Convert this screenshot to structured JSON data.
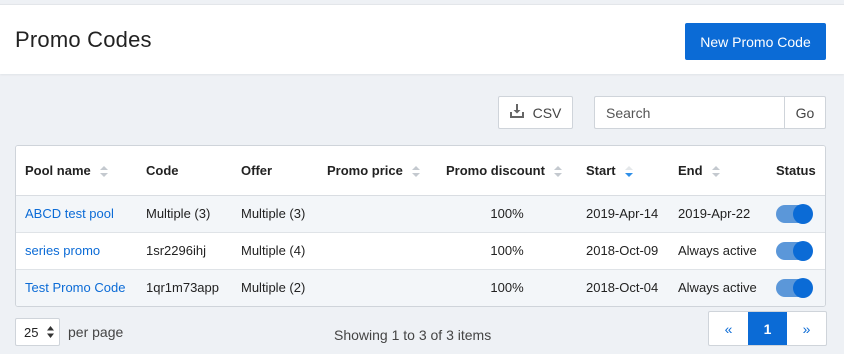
{
  "header": {
    "title": "Promo Codes",
    "new_button": "New Promo Code"
  },
  "toolbar": {
    "csv_label": "CSV",
    "search_placeholder": "Search",
    "search_value": "",
    "go_label": "Go"
  },
  "table": {
    "columns": [
      "Pool name",
      "Code",
      "Offer",
      "Promo price",
      "Promo discount",
      "Start",
      "End",
      "Status"
    ],
    "sorted_column": "Start",
    "rows": [
      {
        "pool_name": "ABCD test pool",
        "code": "Multiple (3)",
        "offer": "Multiple (3)",
        "promo_price": "",
        "promo_discount": "100%",
        "start": "2019-Apr-14",
        "end": "2019-Apr-22",
        "status_on": true
      },
      {
        "pool_name": "series promo",
        "code": "1sr2296ihj",
        "offer": "Multiple (4)",
        "promo_price": "",
        "promo_discount": "100%",
        "start": "2018-Oct-09",
        "end": "Always active",
        "status_on": true
      },
      {
        "pool_name": "Test Promo Code",
        "code": "1qr1m73app",
        "offer": "Multiple (2)",
        "promo_price": "",
        "promo_discount": "100%",
        "start": "2018-Oct-04",
        "end": "Always active",
        "status_on": true
      }
    ]
  },
  "footer": {
    "per_page_value": "25",
    "per_page_label": "per page",
    "showing_text": "Showing 1 to 3 of 3 items",
    "pager": {
      "prev": "«",
      "current": "1",
      "next": "»"
    }
  },
  "colors": {
    "accent": "#0b6bd6",
    "toggle_track": "#5b97d9",
    "background": "#eef1f5"
  }
}
